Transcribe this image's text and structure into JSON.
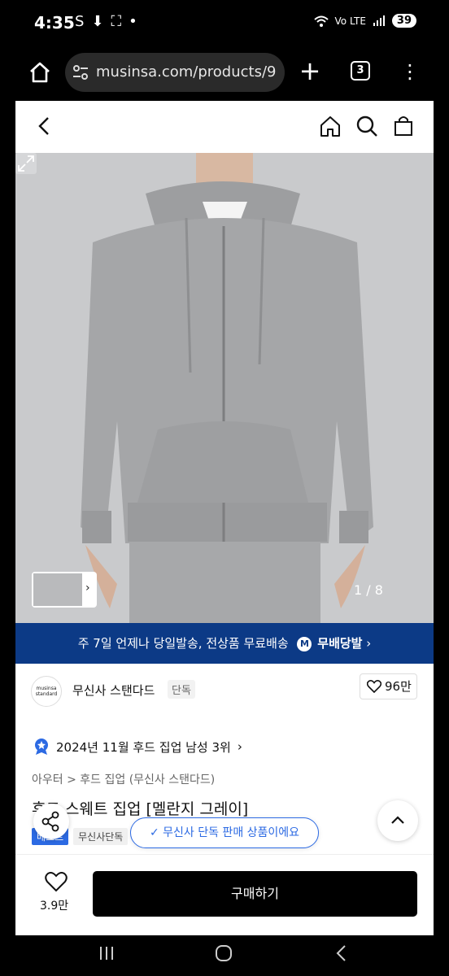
{
  "status_bar": {
    "time": "4:35",
    "left_icons": [
      "S",
      "⬇",
      "⛶",
      "•"
    ],
    "network": "Vo LTE",
    "battery": "39"
  },
  "browser": {
    "url": "musinsa.com/products/9",
    "tab_count": "3"
  },
  "hero": {
    "counter": "1 / 8",
    "background_color": "#c9cacc"
  },
  "banner": {
    "text": "주 7일 언제나 당일발송, 전상품 무료배송",
    "logo": "M",
    "brand_text": "무배당발",
    "chevron": "›",
    "color": "#0c3a86"
  },
  "brand": {
    "logo_line1": "musinsa",
    "logo_line2": "standard",
    "name": "무신사 스탠다드",
    "tag": "단독",
    "likes": "96만"
  },
  "product": {
    "ranking": "2024년 11월 후드 집업 남성 3위",
    "ranking_chevron": "›",
    "breadcrumb": "아우터 > 후드 집업 (무신사 스탠다드)",
    "title": "후드 스웨트 집업 [멜란지 그레이]",
    "tag_blue": "베스트",
    "tag_grey": "무신사단독"
  },
  "toast": {
    "text": "✓ 무신사 단독 판매 상품이에요"
  },
  "bottom_bar": {
    "wish_count": "3.9만",
    "buy_label": "구매하기"
  }
}
